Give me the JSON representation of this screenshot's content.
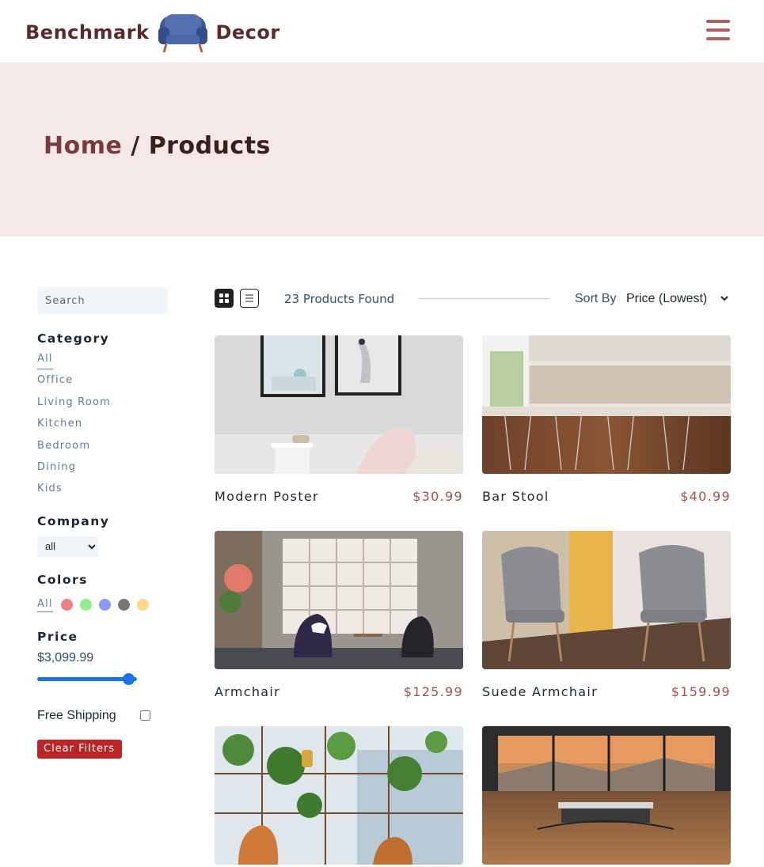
{
  "navbar": {
    "logo_left": "Benchmark",
    "logo_right": "Decor",
    "menu_icon": "hamburger-icon"
  },
  "hero": {
    "home": "Home",
    "separator": " / ",
    "current": "Products"
  },
  "filters": {
    "search_placeholder": "Search",
    "category_title": "Category",
    "categories": [
      "All",
      "Office",
      "Living Room",
      "Kitchen",
      "Bedroom",
      "Dining",
      "Kids"
    ],
    "company_title": "Company",
    "company_selected": "all",
    "colors_title": "Colors",
    "colors_all": "All",
    "colors": [
      "#f08080",
      "#90ee90",
      "#8899ff",
      "#777777",
      "#ffd98a"
    ],
    "price_title": "Price",
    "price_value": "$3,099.99",
    "price_slider_fraction": 0.92,
    "shipping_label": "Free Shipping",
    "shipping_checked": false,
    "clear_label": "Clear Filters"
  },
  "toolbar": {
    "grid_icon": "grid-view-icon",
    "list_icon": "list-view-icon",
    "count": "23 Products Found",
    "sort_label": "Sort By",
    "sort_selected": "Price (Lowest)"
  },
  "products": [
    {
      "name": "Modern Poster",
      "price": "$30.99"
    },
    {
      "name": "Bar Stool",
      "price": "$40.99"
    },
    {
      "name": "Armchair",
      "price": "$125.99"
    },
    {
      "name": "Suede Armchair",
      "price": "$159.99"
    },
    {
      "name": "",
      "price": ""
    },
    {
      "name": "",
      "price": ""
    }
  ],
  "colors": {
    "brand_dark": "#5a2a2a",
    "brand_accent": "#b0615f",
    "hero_bg": "#f5e8e8",
    "clear_btn": "#bb2525",
    "slider": "#1a73e8"
  }
}
